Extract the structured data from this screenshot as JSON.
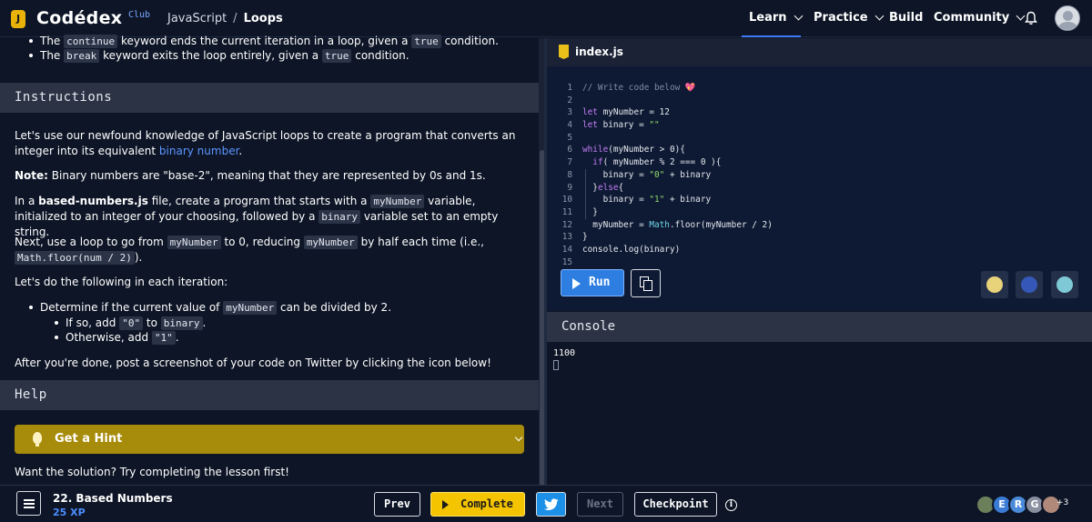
{
  "app": {
    "logo": "Codédex",
    "logo_tag": "Club",
    "logo_mark": "J"
  },
  "breadcrumb": {
    "course": "JavaScript",
    "separator": "/",
    "current": "Loops"
  },
  "nav": {
    "items": [
      {
        "label": "Learn",
        "has_menu": true,
        "active": true
      },
      {
        "label": "Practice",
        "has_menu": true
      },
      {
        "label": "Build",
        "has_menu": false
      },
      {
        "label": "Community",
        "has_menu": true
      }
    ]
  },
  "lesson": {
    "top_bullets": [
      {
        "pre": "The ",
        "code": "continue",
        "mid": " keyword ends the current iteration in a loop, given a ",
        "code2": "true",
        "post": " condition."
      },
      {
        "pre": "The ",
        "code": "break",
        "mid": " keyword exits the loop entirely, given a ",
        "code2": "true",
        "post": " condition."
      }
    ],
    "instructions_heading": "Instructions",
    "p1_a": "Let's use our newfound knowledge of JavaScript loops to create a program that converts an integer into its equivalent ",
    "p1_link": "binary number",
    "p1_b": ".",
    "p2_bold": "Note:",
    "p2_rest": " Binary numbers are \"base-2\", meaning that they are represented by 0s and 1s.",
    "p3_a": "In a ",
    "p3_file": "based-numbers.js",
    "p3_b": " file, create a program that starts with a ",
    "p3_code1": "myNumber",
    "p3_c": " variable, initialized to an integer of your choosing, followed by a ",
    "p3_code2": "binary",
    "p3_d": " variable set to an empty string.",
    "p4_a": "Next, use a loop to go from ",
    "p4_code1": "myNumber",
    "p4_b": " to 0, reducing ",
    "p4_code2": "myNumber",
    "p4_c": " by half each time (i.e., ",
    "p4_code3": "Math.floor(num / 2)",
    "p4_d": ").",
    "p5": "Let's do the following in each iteration:",
    "step_a": "Determine if the current value of ",
    "step_code": "myNumber",
    "step_b": " can be divided by 2.",
    "sub1_a": "If so, add ",
    "sub1_code1": "\"0\"",
    "sub1_b": " to ",
    "sub1_code2": "binary",
    "sub1_c": ".",
    "sub2_a": "Otherwise, add ",
    "sub2_code": "\"1\"",
    "sub2_b": ".",
    "p6": "After you're done, post a screenshot of your code on Twitter by clicking the icon below!",
    "help_heading": "Help",
    "hint_label": "Get a Hint",
    "solution_note": "Want the solution? Try completing the lesson first!"
  },
  "editor": {
    "filename": "index.js",
    "lines": [
      {
        "n": "1",
        "html": "<span class=\"cm\">// Write code below 💖</span>"
      },
      {
        "n": "2",
        "html": ""
      },
      {
        "n": "3",
        "html": "<span class=\"kw\">let</span> myNumber = 12"
      },
      {
        "n": "4",
        "html": "<span class=\"kw\">let</span> binary = <span class=\"str\">\"\"</span>"
      },
      {
        "n": "5",
        "html": ""
      },
      {
        "n": "6",
        "html": "<span class=\"kw\">while</span>(myNumber > 0){"
      },
      {
        "n": "7",
        "html": "  <span class=\"kw\">if</span>( myNumber % 2 === 0 ){"
      },
      {
        "n": "8",
        "html": "    binary = <span class=\"str\">\"0\"</span> + binary"
      },
      {
        "n": "9",
        "html": "  }<span class=\"kw\">else</span>{"
      },
      {
        "n": "10",
        "html": "    binary = <span class=\"str\">\"1\"</span> + binary"
      },
      {
        "n": "11",
        "html": "  }"
      },
      {
        "n": "12",
        "html": "  myNumber = <span class=\"fn\">Math</span>.floor(myNumber / 2)"
      },
      {
        "n": "13",
        "html": "}"
      },
      {
        "n": "14",
        "html": "console.log(binary)"
      },
      {
        "n": "15",
        "html": ""
      }
    ],
    "run_label": "Run"
  },
  "console": {
    "heading": "Console",
    "output": "1100"
  },
  "footer": {
    "lesson_title": "22. Based Numbers",
    "xp": "25 XP",
    "prev_label": "Prev",
    "complete_label": "Complete",
    "next_label": "Next",
    "checkpoint_label": "Checkpoint",
    "info_glyph": "i",
    "avatars": [
      {
        "initial": "",
        "color": "#6b7f5a"
      },
      {
        "initial": "E",
        "color": "#3a7bd5"
      },
      {
        "initial": "R",
        "color": "#4a8ad9"
      },
      {
        "initial": "G",
        "color": "#8a8fa0"
      },
      {
        "initial": "",
        "color": "#b0897a"
      }
    ],
    "more_count": "+3"
  },
  "colors": {
    "accent": "#3e7bfa",
    "hint_bar": "#a78b0a",
    "complete_button": "#f5c400",
    "run_button": "#2d7ee0",
    "twitter": "#1c8fe6"
  }
}
